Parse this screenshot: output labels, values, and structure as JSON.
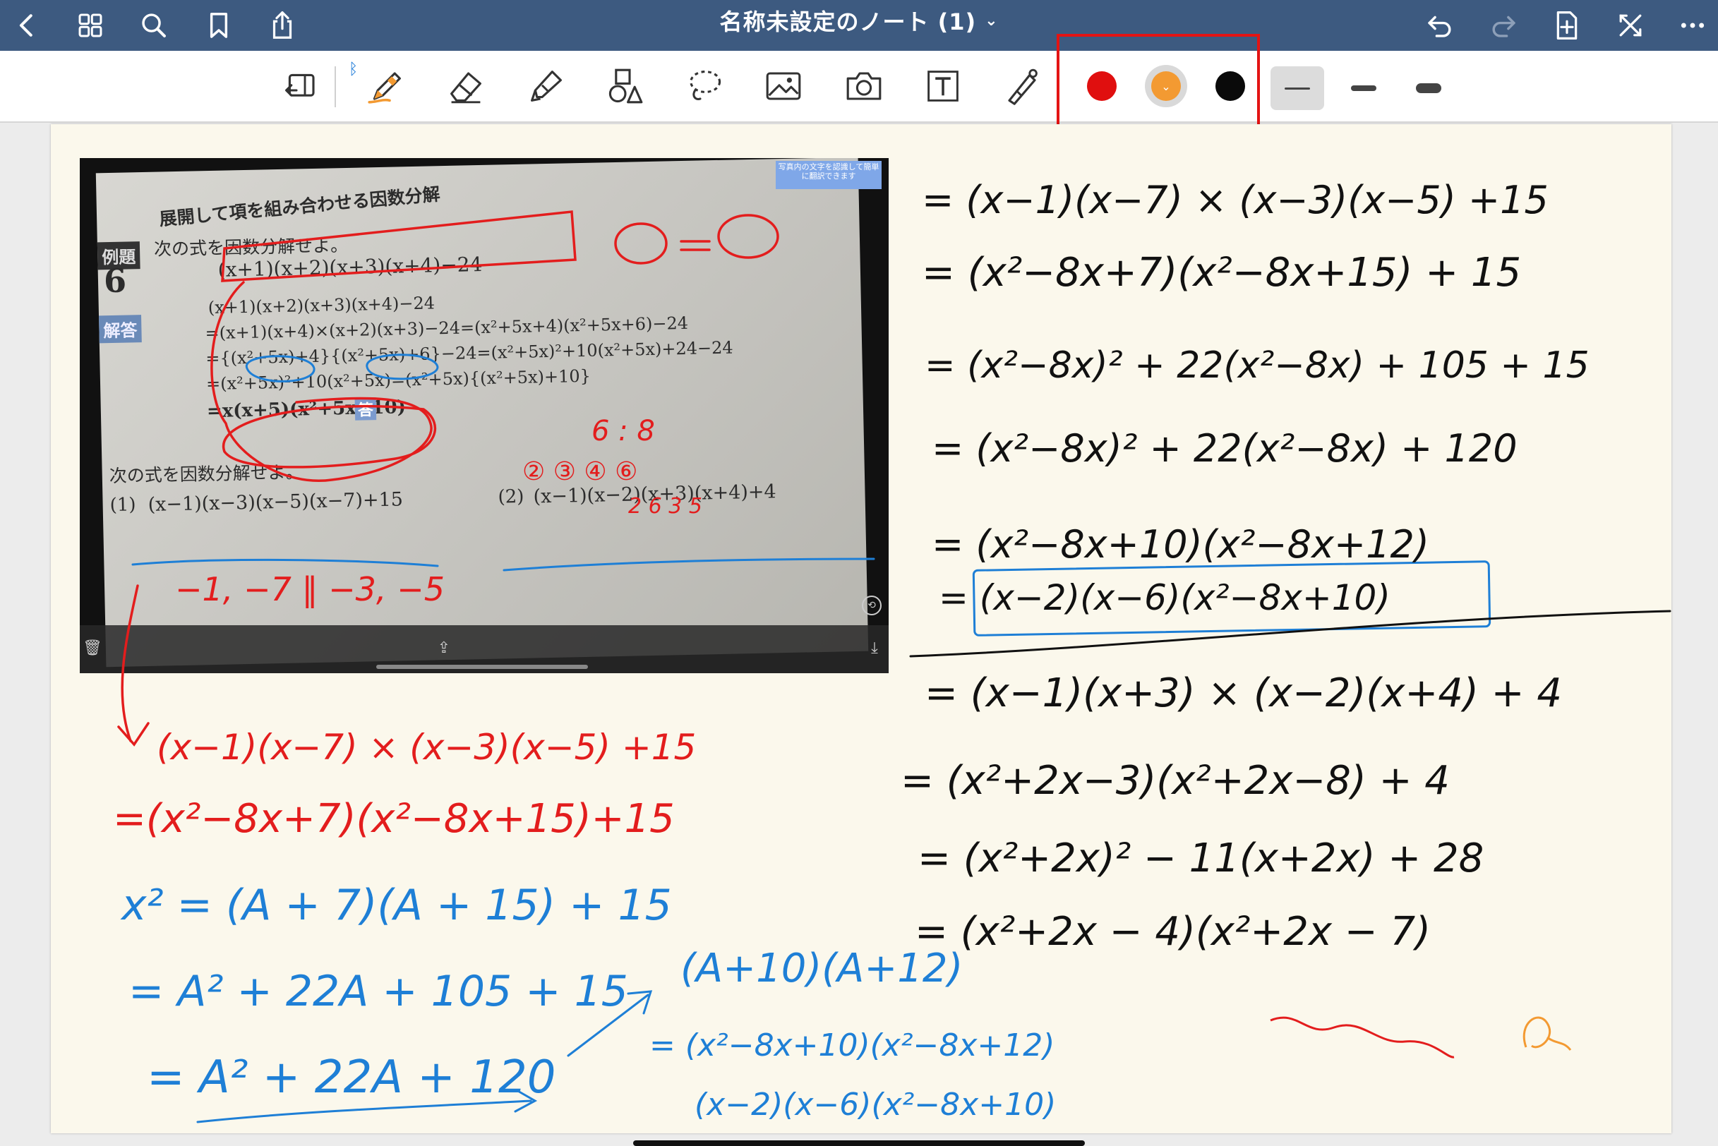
{
  "topbar": {
    "title": "名称未設定のノート (1)",
    "left_icons": [
      "back-icon",
      "grid-icon",
      "search-icon",
      "bookmark-icon",
      "share-icon"
    ],
    "right_icons": [
      "undo-icon",
      "redo-icon",
      "add-page-icon",
      "close-fullscreen-icon",
      "more-icon"
    ]
  },
  "toolbar": {
    "tools": [
      "read-mode-icon",
      "pen-icon",
      "eraser-icon",
      "highlighter-icon",
      "shapes-icon",
      "lasso-icon",
      "image-icon",
      "camera-icon",
      "text-icon",
      "laser-pointer-icon"
    ],
    "selected_tool": "pen-icon",
    "colors": [
      {
        "name": "red",
        "hex": "#e00f0f"
      },
      {
        "name": "orange",
        "hex": "#f39a32"
      },
      {
        "name": "black",
        "hex": "#0a0a0a"
      }
    ],
    "selected_color": "orange",
    "thickness": [
      "thin",
      "medium",
      "thick"
    ],
    "selected_thickness": "thin"
  },
  "photo": {
    "heading": "展開して項を組み合わせる因数分解",
    "example_label": "例題",
    "example_number": "6",
    "instruction": "次の式を因数分解せよ。",
    "problem": "(x+1)(x+2)(x+3)(x+4)−24",
    "answer_tag": "解答",
    "lines": [
      "(x+1)(x+2)(x+3)(x+4)−24",
      "=(x+1)(x+4)×(x+2)(x+3)−24=(x²+5x+4)(x²+5x+6)−24",
      "={(x²+5x)+4}{(x²+5x)+6}−24=(x²+5x)²+10(x²+5x)+24−24",
      "=(x²+5x)²+10(x²+5x)=(x²+5x){(x²+5x)+10}",
      "=x(x+5)(x²+5x+10)"
    ],
    "answer_mark": "答",
    "exercise_instruction": "次の式を因数分解せよ。",
    "exercise_1_label": "(1)",
    "exercise_1": "(x−1)(x−3)(x−5)(x−7)+15",
    "exercise_2_label": "(2)",
    "exercise_2": "(x−1)(x−2)(x+3)(x+4)+4",
    "translate_badge": "写真内の文字を認識して簡単に翻訳できます"
  },
  "handwriting": {
    "photo_notes": [
      "−1, −7 ‖ −3, −5",
      "6 : 8",
      "② ③ ④ ⑥",
      "2 6   3 5"
    ],
    "red_work": [
      "(x−1)(x−7) × (x−3)(x−5) +15",
      "=(x²−8x+7)(x²−8x+15)+15"
    ],
    "blue_work": [
      "x² = (A + 7)(A + 15) + 15",
      "= A² + 22A + 105 + 15",
      "= A² + 22A + 120",
      "(A+10)(A+12)",
      "= (x²−8x+10)(x²−8x+12)",
      "(x−2)(x−6)(x²−8x+10)"
    ],
    "black_work_1": [
      "= (x−1)(x−7) × (x−3)(x−5) +15",
      "= (x²−8x+7)(x²−8x+15) + 15",
      "= (x²−8x)² + 22(x²−8x) + 105 + 15",
      "= (x²−8x)² + 22(x²−8x) + 120",
      "= (x²−8x+10)(x²−8x+12)",
      "= (x−2)(x−6)(x²−8x+10)"
    ],
    "black_work_2": [
      "= (x−1)(x+3) × (x−2)(x+4) + 4",
      "= (x²+2x−3)(x²+2x−8) + 4",
      "= (x²+2x)² − 11(x+2x) + 28",
      "= (x²+2x − 4)(x²+2x − 7)"
    ]
  }
}
